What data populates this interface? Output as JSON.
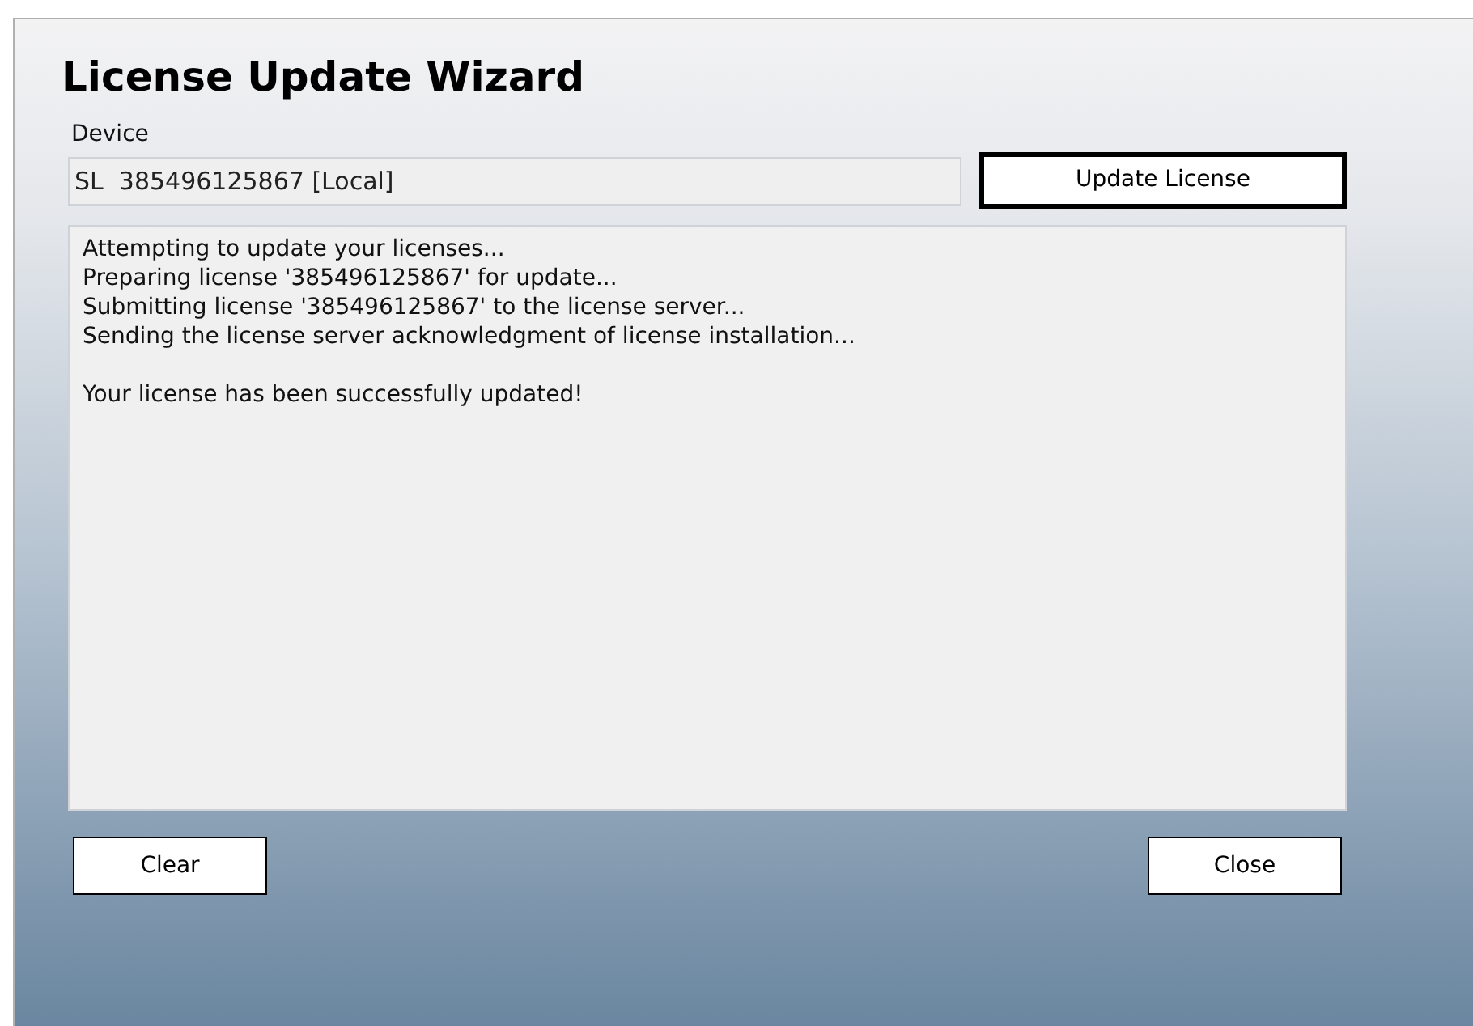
{
  "window": {
    "title": "License Update Wizard"
  },
  "device": {
    "label": "Device",
    "value": "SL  385496125867 [Local]"
  },
  "update_button": "Update License",
  "log": {
    "paragraphs": [
      [
        "Attempting to update your licenses...",
        "Preparing license '385496125867' for update...",
        "Submitting license '385496125867' to the license server...",
        "Sending the license server acknowledgment of license installation..."
      ],
      [
        "Your license has been successfully updated!"
      ]
    ]
  },
  "buttons": {
    "left": "Clear",
    "right": "Close"
  }
}
